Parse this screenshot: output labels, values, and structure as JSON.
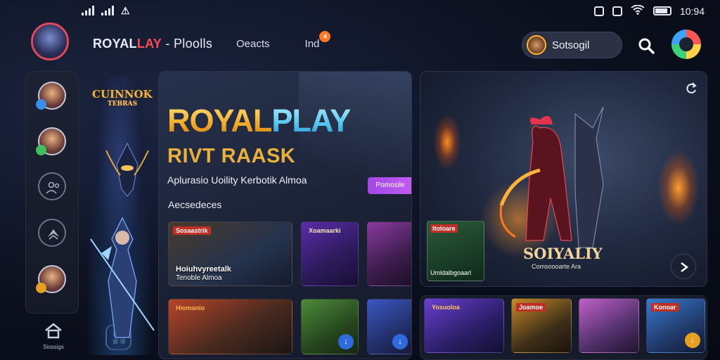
{
  "statusbar": {
    "time": "10:94",
    "battery_level": 0.85
  },
  "header": {
    "brand_highlight": "ROYALLAY",
    "brand_prefix": "ROYAL",
    "brand_red": "LAY",
    "brand_rest": " - Ploolls",
    "nav": [
      {
        "label": "Oeacts",
        "badge": ""
      },
      {
        "label": "Ind",
        "badge": "4"
      }
    ],
    "user": {
      "name": "Sotsogil"
    }
  },
  "sidebar": {
    "home_label": "Siossigs"
  },
  "left_art": {
    "logo_line1": "CUINNOK",
    "logo_line2": "TEBRAS"
  },
  "center": {
    "headline_part1": "ROYAL",
    "headline_part2": "PLAY",
    "subhead": "RIVT RAASK",
    "tagline": "Aplurasio Uoility Kerbotik Almoa",
    "cta_label": "Pomosile",
    "section_label": "Aecsedeces",
    "thumbs": [
      {
        "tag": "Sosaastrik",
        "caption_line1": "Hoiuhvyreetalk",
        "caption_line2": "Tenoble Almoa"
      },
      {
        "tag": "Xoamaarki",
        "caption_line1": "",
        "caption_line2": ""
      },
      {
        "tag": "",
        "caption_line1": "",
        "caption_line2": ""
      },
      {
        "tag": "Hiomanio",
        "caption_line1": "",
        "caption_line2": ""
      },
      {
        "tag": "",
        "caption_line1": "",
        "caption_line2": ""
      },
      {
        "tag": "",
        "caption_line1": "",
        "caption_line2": ""
      }
    ]
  },
  "hero": {
    "title": "SOIYALIY",
    "subtitle": "Comsoooarte Ara",
    "mini_tag": "Itoloare",
    "mini_caption": "Umldalbgoaarl"
  },
  "bottom_row": [
    {
      "tag": "Yosuoloa"
    },
    {
      "tag": "Joamoe"
    },
    {
      "tag": ""
    },
    {
      "tag": "Konoar"
    }
  ],
  "colors": {
    "brand_red": "#ff4a55",
    "accent_purple": "#b052ec",
    "gold": "#f2a825",
    "cyan": "#4fc6f1"
  }
}
